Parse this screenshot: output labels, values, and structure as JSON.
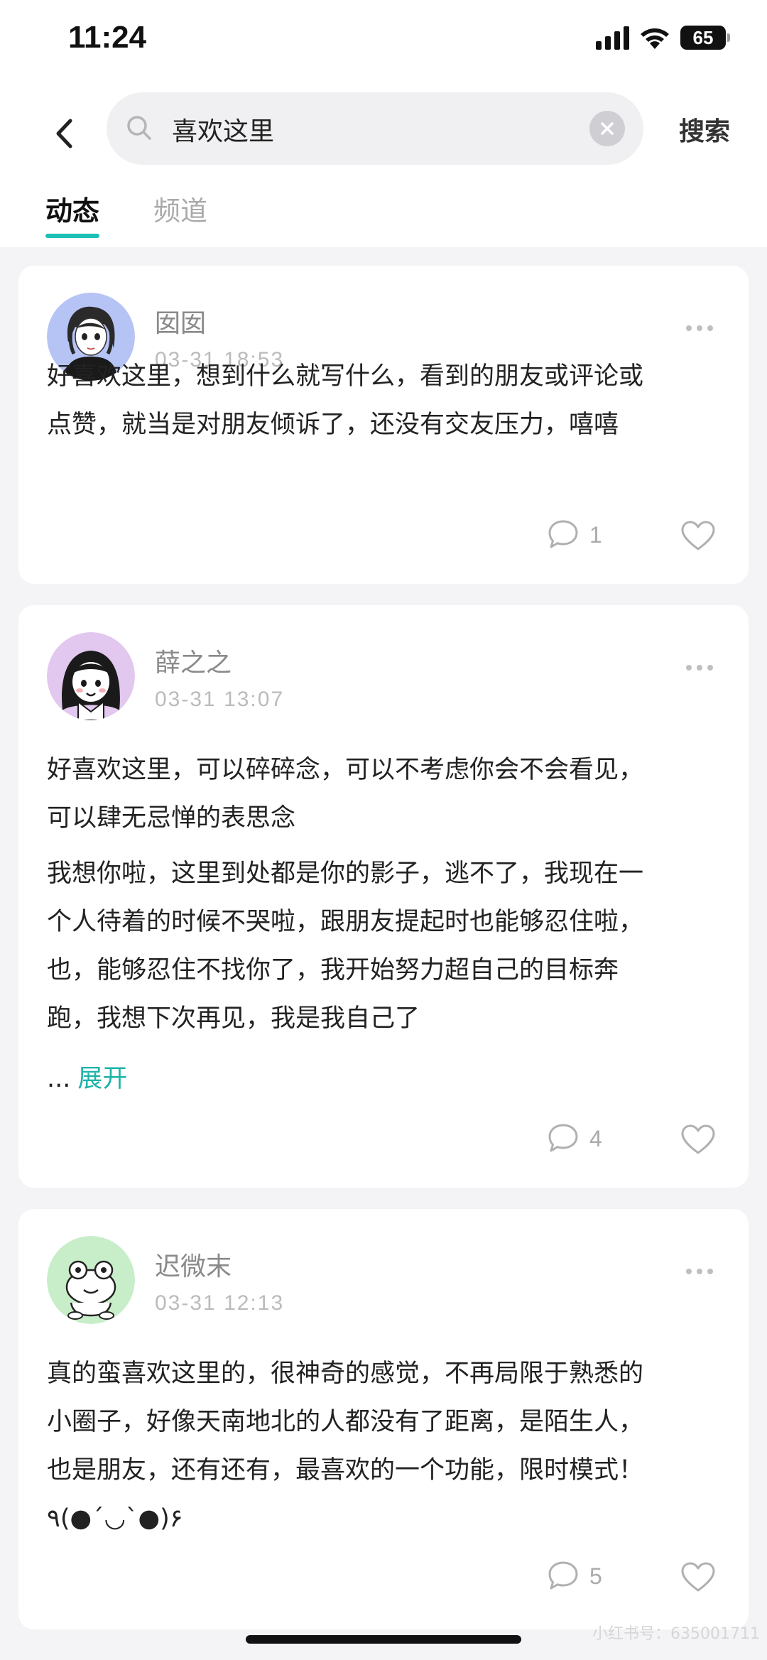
{
  "status_bar": {
    "time": "11:24",
    "battery": "65",
    "icons": [
      "signal-icon",
      "wifi-icon",
      "battery-icon"
    ]
  },
  "search": {
    "query": "喜欢这里",
    "submit_label": "搜索",
    "icons": [
      "back-icon",
      "search-icon",
      "clear-icon"
    ]
  },
  "tabs": [
    {
      "label": "动态",
      "active": true
    },
    {
      "label": "频道",
      "active": false
    }
  ],
  "posts": [
    {
      "user": "囡囡",
      "time": "03-31 18:53",
      "paragraphs": [
        "好喜欢这里，想到什么就写什么，看到的朋友或评论或\n点赞，就当是对朋友倾诉了，还没有交友压力，嘻嘻"
      ],
      "comments": "1",
      "avatar": "girl-portrait-avatar"
    },
    {
      "user": "薛之之",
      "time": "03-31 13:07",
      "paragraphs": [
        "好喜欢这里，可以碎碎念，可以不考虑你会不会看见，\n可以肆无忌惮的表思念",
        "我想你啦，这里到处都是你的影子，逃不了，我现在一\n个人待着的时候不哭啦，跟朋友提起时也能够忍住啦，\n也，能够忍住不找你了，我开始努力超自己的目标奔\n跑，我想下次再见，我是我自己了"
      ],
      "ellipsis": "...",
      "expand_label": "展开",
      "comments": "4",
      "avatar": "cartoon-girl-avatar"
    },
    {
      "user": "迟微末",
      "time": "03-31 12:13",
      "paragraphs": [
        "真的蛮喜欢这里的，很神奇的感觉，不再局限于熟悉的\n小圈子，好像天南地北的人都没有了距离，是陌生人，\n也是朋友，还有还有，最喜欢的一个功能，限时模式！\n٩(●´◡`●)۶"
      ],
      "comments": "5",
      "avatar": "frog-avatar"
    }
  ],
  "watermark": "小红书号：635001711",
  "colors": {
    "accent": "#1dbfb4",
    "background": "#f4f4f6",
    "card": "#ffffff"
  }
}
